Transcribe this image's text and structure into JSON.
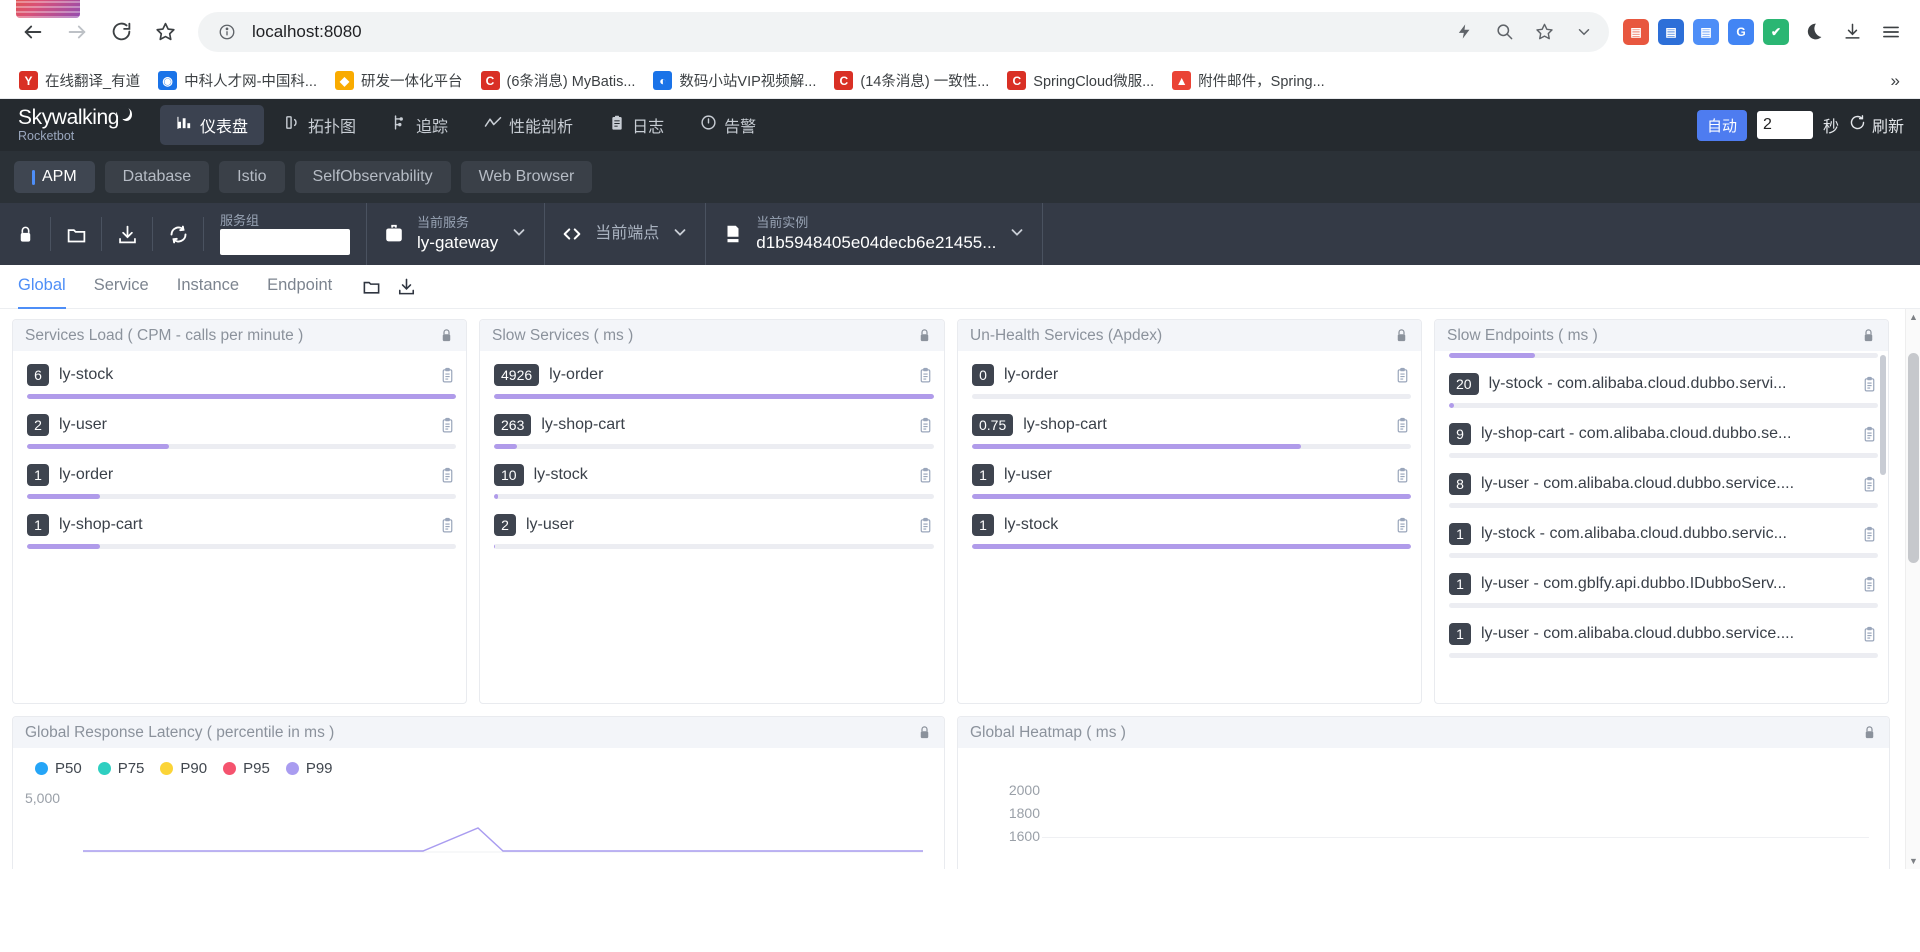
{
  "browser": {
    "url": "localhost:8080",
    "nav": {
      "back": "back-arrow",
      "forward": "forward-arrow",
      "reload": "reload",
      "star": "bookmark-star"
    },
    "omni_icons": [
      "info-circle",
      "lightning",
      "zoom-search",
      "star",
      "chevron-down"
    ],
    "extensions": [
      {
        "name": "red-grid-ext",
        "glyph": "⌸",
        "color": "#e8573f"
      },
      {
        "name": "blue-doc-ext",
        "glyph": "▤",
        "color": "#2d6fd8"
      },
      {
        "name": "apps-ext",
        "glyph": "☷",
        "color": "#4e8ef7"
      },
      {
        "name": "google-translate-ext",
        "glyph": "G",
        "color": "#4285f4"
      },
      {
        "name": "shield-ext",
        "glyph": "✔",
        "color": "#2bb673"
      }
    ],
    "toolbar_plain": [
      "moon-icon",
      "download-icon",
      "menu-icon"
    ],
    "bookmarks": [
      {
        "label": "在线翻译_有道",
        "fav": "Y",
        "color": "#d93025"
      },
      {
        "label": "中科人才网-中国科...",
        "fav": "◉",
        "color": "#1a73e8"
      },
      {
        "label": "研发一体化平台",
        "fav": "◆",
        "color": "#f9ab00"
      },
      {
        "label": "(6条消息) MyBatis...",
        "fav": "C",
        "color": "#d93025"
      },
      {
        "label": "数码小站VIP视频解...",
        "fav": "◐",
        "color": "#1a73e8"
      },
      {
        "label": "(14条消息) 一致性...",
        "fav": "C",
        "color": "#d93025"
      },
      {
        "label": "SpringCloud微服...",
        "fav": "C",
        "color": "#d93025"
      },
      {
        "label": "附件邮件，Spring...",
        "fav": "▲",
        "color": "#ea4335"
      }
    ],
    "bookmarks_overflow": "»"
  },
  "app": {
    "logo_text": "Skywalking",
    "logo_sub": "Rocketbot",
    "nav": [
      {
        "label": "仪表盘",
        "icon": "dashboard-icon",
        "active": true
      },
      {
        "label": "拓扑图",
        "icon": "topology-icon",
        "active": false
      },
      {
        "label": "追踪",
        "icon": "trace-icon",
        "active": false
      },
      {
        "label": "性能剖析",
        "icon": "profile-icon",
        "active": false
      },
      {
        "label": "日志",
        "icon": "log-icon",
        "active": false
      },
      {
        "label": "告警",
        "icon": "alarm-icon",
        "active": false
      }
    ],
    "auto_label": "自动",
    "auto_value": "2",
    "auto_unit": "秒",
    "refresh_label": "刷新"
  },
  "apm_tabs": [
    {
      "label": "APM",
      "active": true
    },
    {
      "label": "Database",
      "active": false
    },
    {
      "label": "Istio",
      "active": false
    },
    {
      "label": "SelfObservability",
      "active": false
    },
    {
      "label": "Web Browser",
      "active": false
    }
  ],
  "selector": {
    "icons": [
      "lock-icon",
      "folder-icon",
      "download-icon",
      "refresh-icon"
    ],
    "service_group": {
      "label": "服务组",
      "value": "",
      "placeholder": ""
    },
    "current_service": {
      "label": "当前服务",
      "value": "ly-gateway",
      "icon": "service-bag-icon"
    },
    "current_endpoint": {
      "label": "当前端点",
      "value": "",
      "icon": "code-brackets-icon"
    },
    "current_instance": {
      "label": "当前实例",
      "value": "d1b5948405e04decb6e21455...",
      "icon": "instance-icon"
    }
  },
  "sub_tabs": [
    {
      "label": "Global",
      "active": true
    },
    {
      "label": "Service",
      "active": false
    },
    {
      "label": "Instance",
      "active": false
    },
    {
      "label": "Endpoint",
      "active": false
    }
  ],
  "sub_tab_icons": [
    "folder-icon",
    "download-icon"
  ],
  "chart_data": [
    {
      "type": "bar",
      "title": "Services Load ( CPM - calls per minute )",
      "orientation": "horizontal-ranked-list",
      "categories": [
        "ly-stock",
        "ly-user",
        "ly-order",
        "ly-shop-cart"
      ],
      "values": [
        6,
        2,
        1,
        1
      ],
      "percents": [
        100,
        33,
        17,
        17
      ],
      "xlabel": "",
      "ylabel": "CPM",
      "grid": false,
      "legend": "none"
    },
    {
      "type": "bar",
      "title": "Slow Services ( ms )",
      "orientation": "horizontal-ranked-list",
      "categories": [
        "ly-order",
        "ly-shop-cart",
        "ly-stock",
        "ly-user"
      ],
      "values": [
        4926,
        263,
        10,
        2
      ],
      "percents": [
        100,
        5,
        1,
        0.4
      ],
      "xlabel": "",
      "ylabel": "ms",
      "grid": false,
      "legend": "none"
    },
    {
      "type": "bar",
      "title": "Un-Health Services (Apdex)",
      "orientation": "horizontal-ranked-list",
      "categories": [
        "ly-order",
        "ly-shop-cart",
        "ly-user",
        "ly-stock"
      ],
      "values": [
        0,
        0.75,
        1,
        1
      ],
      "percents": [
        0,
        75,
        100,
        100
      ],
      "xlabel": "",
      "ylabel": "Apdex",
      "ylim": [
        0,
        1
      ],
      "grid": false,
      "legend": "none"
    },
    {
      "type": "bar",
      "title": "Slow Endpoints ( ms )",
      "orientation": "horizontal-ranked-list",
      "scrolled": true,
      "categories": [
        "ly-stock - com.alibaba.cloud.dubbo.servi...",
        "ly-shop-cart - com.alibaba.cloud.dubbo.se...",
        "ly-user - com.alibaba.cloud.dubbo.service....",
        "ly-stock - com.alibaba.cloud.dubbo.servic...",
        "ly-user - com.gblfy.api.dubbo.IDubboServ...",
        "ly-user - com.alibaba.cloud.dubbo.service...."
      ],
      "values": [
        20,
        9,
        8,
        1,
        1,
        1
      ],
      "percents": [
        2,
        0.5,
        0.5,
        0.3,
        0.3,
        0.3
      ],
      "clipped_row_percent": 20,
      "xlabel": "",
      "ylabel": "ms",
      "grid": false,
      "legend": "none"
    },
    {
      "type": "line",
      "title": "Global Response Latency ( percentile in ms )",
      "series": [
        {
          "name": "P50",
          "color": "#25a5f7"
        },
        {
          "name": "P75",
          "color": "#2ecfc1"
        },
        {
          "name": "P90",
          "color": "#fbd437"
        },
        {
          "name": "P95",
          "color": "#f5536e"
        },
        {
          "name": "P99",
          "color": "#a99cf0"
        }
      ],
      "ylabel": "ms",
      "y_ticks": [
        "5,000"
      ],
      "legend": "top-left",
      "grid": true
    },
    {
      "type": "heatmap",
      "title": "Global Heatmap ( ms )",
      "ylabel": "ms",
      "y_ticks": [
        "2000",
        "1800",
        "1600"
      ],
      "grid": true,
      "legend": "none"
    }
  ],
  "icons": {
    "copy": "clipboard-copy-icon",
    "lock": "lock-icon"
  }
}
